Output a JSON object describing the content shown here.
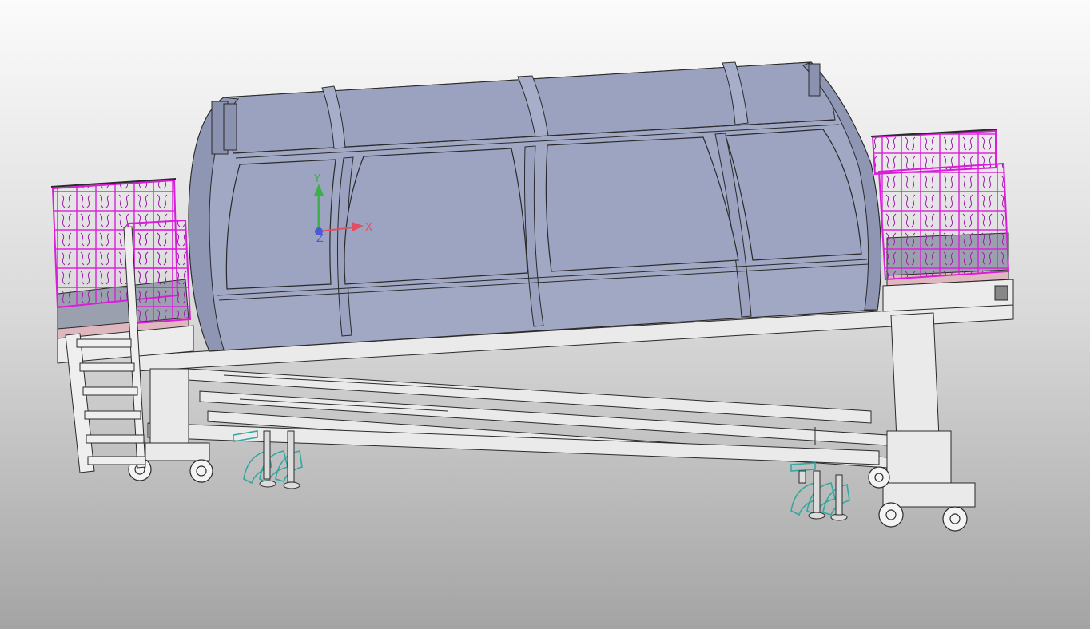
{
  "viewport": {
    "triad": {
      "x_label": "X",
      "y_label": "Y",
      "z_label": "Z"
    }
  },
  "colors": {
    "cabin_body": "#a0a8c4",
    "cabin_dark": "#8e96b4",
    "wire": "#2a2a2a",
    "railing": "#d81ed8",
    "anchor": "#33a8a0",
    "frame": "#e6e6e6",
    "deck": "#9aa0ae",
    "deck_pink": "#dfb8bf",
    "axis_x": "#e05060",
    "axis_y": "#3cb04a",
    "axis_z": "#4a5ad0"
  },
  "icons": {
    "triad": "coordinate-triad-icon"
  }
}
